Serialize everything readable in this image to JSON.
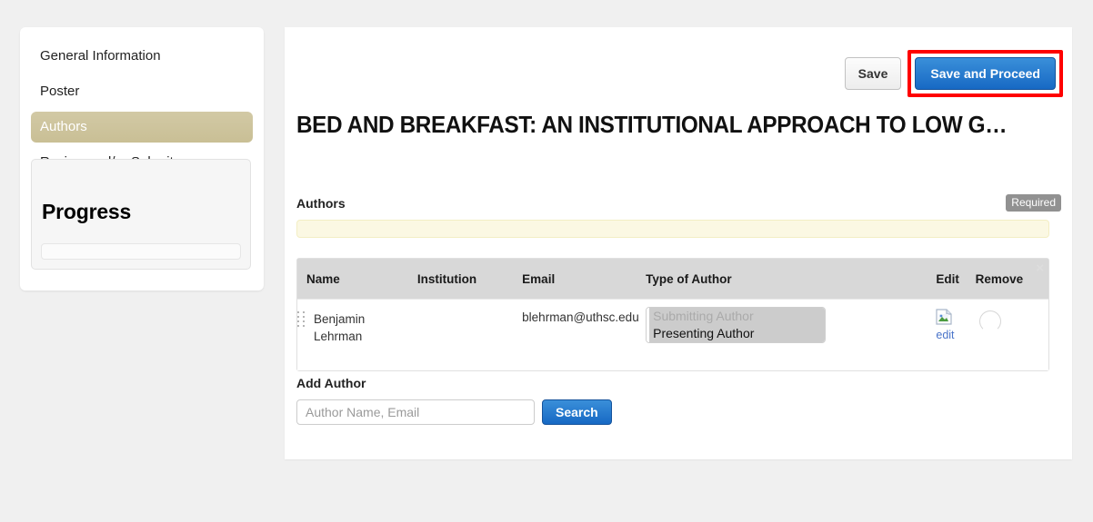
{
  "sidebar": {
    "items": [
      {
        "label": "General Information",
        "active": false
      },
      {
        "label": "Poster",
        "active": false
      },
      {
        "label": "Authors",
        "active": true
      },
      {
        "label": "Review and/or Submit",
        "active": false
      }
    ],
    "progress": {
      "title": "Progress",
      "percent": 0
    }
  },
  "toolbar": {
    "save_label": "Save",
    "save_and_proceed_label": "Save and Proceed",
    "highlight_color": "#ff0000",
    "primary_color": "#1769c4"
  },
  "main": {
    "submission_title": "BED AND BREAKFAST: AN INSTITUTIONAL APPROACH TO LOW G…",
    "section_label": "Authors",
    "required_badge": "Required",
    "alert_text": "",
    "table_close_icon": "×",
    "columns": [
      "Name",
      "Institution",
      "Email",
      "Type of Author",
      "Edit",
      "Remove"
    ],
    "rows": [
      {
        "name": "Benjamin Lehrman",
        "name_line1": "Benjamin",
        "name_line2": "Lehrman",
        "institution": "",
        "email": "blehrman@uthsc.edu",
        "type_options": [
          {
            "label": "Submitting Author",
            "selected": false,
            "dim": true
          },
          {
            "label": "Presenting Author",
            "selected": true,
            "dim": false
          }
        ],
        "edit_label": "edit",
        "remove_label": ""
      }
    ],
    "add_author": {
      "label": "Add Author",
      "input_value": "",
      "input_placeholder": "Author Name, Email",
      "search_label": "Search"
    }
  }
}
